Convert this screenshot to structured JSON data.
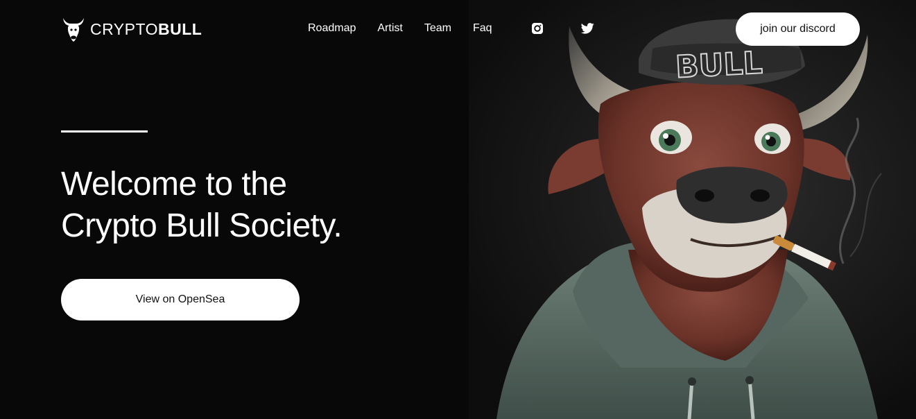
{
  "brand": {
    "logo_icon": "bull-head-icon",
    "name_light": "CRYPTO",
    "name_bold": "BULL"
  },
  "nav": {
    "items": [
      {
        "label": "Roadmap"
      },
      {
        "label": "Artist"
      },
      {
        "label": "Team"
      },
      {
        "label": "Faq"
      }
    ]
  },
  "social": {
    "instagram_icon": "instagram-icon",
    "twitter_icon": "twitter-icon"
  },
  "header": {
    "discord_button_label": "join our discord"
  },
  "hero": {
    "headline_line1": "Welcome to the",
    "headline_line2": "Crypto Bull Society.",
    "cta_label": "View on OpenSea",
    "cap_text": "BULL"
  },
  "colors": {
    "background": "#080808",
    "text": "#ffffff",
    "button_bg": "#ffffff",
    "button_text": "#111111"
  }
}
